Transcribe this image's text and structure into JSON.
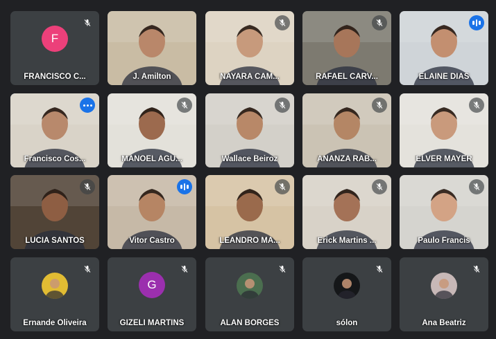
{
  "participants": [
    {
      "name": "FRANCISCO C...",
      "mic": "muted",
      "avatar_letter": "F",
      "avatar_color": "#ec407a"
    },
    {
      "name": "J. Amilton",
      "mic": "none",
      "bg": "#c9bca4",
      "skin": "#b9876a"
    },
    {
      "name": "NAYARA CAM...",
      "mic": "muted",
      "bg": "#ddd3c2",
      "skin": "#c79a7c"
    },
    {
      "name": "RAFAEL CARV...",
      "mic": "muted",
      "bg": "#7d7a70",
      "skin": "#a7765a"
    },
    {
      "name": "ELAINE DIAS",
      "mic": "speaking",
      "bg": "#cfd4d8",
      "skin": "#c38f70"
    },
    {
      "name": "Francisco Cos...",
      "mic": "more",
      "bg": "#d9d3c8",
      "skin": "#b8896c"
    },
    {
      "name": "MANOEL AGU...",
      "mic": "muted",
      "bg": "#e3e1da",
      "skin": "#9c6a4e"
    },
    {
      "name": "Wallace Beiroz",
      "mic": "muted",
      "bg": "#d3d0c9",
      "skin": "#b88868"
    },
    {
      "name": "ANANZA RAB...",
      "mic": "muted",
      "bg": "#cbc3b4",
      "skin": "#b48665"
    },
    {
      "name": "ELVER MAYER",
      "mic": "muted",
      "bg": "#e4e2dc",
      "skin": "#c99a7c"
    },
    {
      "name": "LUCIA SANTOS",
      "mic": "muted",
      "bg": "#514437",
      "skin": "#8e5e43"
    },
    {
      "name": "Vitor Castro",
      "mic": "speaking",
      "bg": "#c6b9a7",
      "skin": "#b68564"
    },
    {
      "name": "LEANDRO MA...",
      "mic": "muted",
      "bg": "#d6c3a4",
      "skin": "#9a6a4c"
    },
    {
      "name": "Érick Martins ...",
      "mic": "muted",
      "bg": "#d8d2c8",
      "skin": "#a47257"
    },
    {
      "name": "Paulo Francis",
      "mic": "muted",
      "bg": "#d5d4cf",
      "skin": "#d3a385"
    },
    {
      "name": "Ernande Oliveira",
      "mic": "muted",
      "avatar_photo": "#e1bc33"
    },
    {
      "name": "GIZELI MARTINS",
      "mic": "muted",
      "avatar_letter": "G",
      "avatar_color": "#9b2fae"
    },
    {
      "name": "ALAN BORGES",
      "mic": "muted",
      "avatar_photo": "#4b6e4f"
    },
    {
      "name": "sólon",
      "mic": "muted",
      "avatar_photo": "#151719"
    },
    {
      "name": "Ana Beatriz",
      "mic": "muted",
      "avatar_photo": "#c7b8b7"
    }
  ]
}
